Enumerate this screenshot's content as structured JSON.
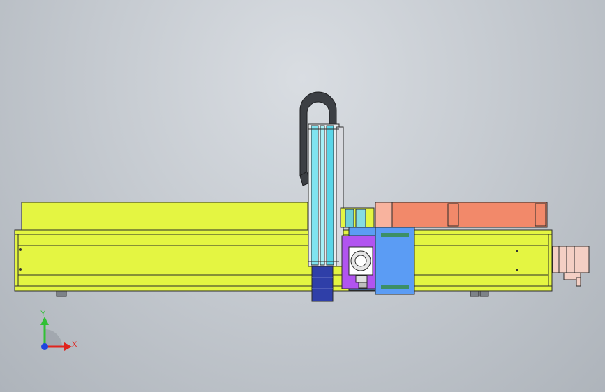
{
  "viewport": {
    "background_top": "#d9dde2",
    "background_bottom": "#aeb4bb"
  },
  "colors": {
    "frame_yellow": "#e4f542",
    "frame_yellow_light": "#eefa6a",
    "outline": "#2a2a2a",
    "salmon_cover": "#f2896a",
    "purple_plate": "#b154f0",
    "blue_block": "#5b9cf4",
    "cyan_rail": "#7fe3ef",
    "navy_motor": "#2f3fa8",
    "dark_cable": "#3c3f44",
    "motor_pink": "#f3cfc4",
    "axis_x": "#e0231d",
    "axis_y": "#31c035",
    "axis_z": "#1f45e0"
  },
  "triad": {
    "x_label": "X",
    "y_label": "Y"
  },
  "model": {
    "icons": [
      "screw-hole-icon",
      "foot-pad-icon",
      "stepper-motor-icon"
    ]
  }
}
